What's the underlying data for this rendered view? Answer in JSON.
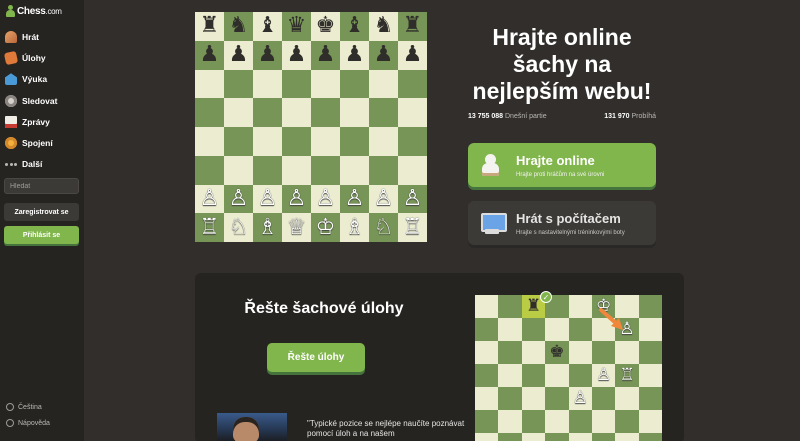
{
  "logo": {
    "name": "Chess",
    "domain": ".com"
  },
  "sidebar": {
    "items": [
      {
        "label": "Hrát",
        "icon": "play-icon"
      },
      {
        "label": "Úlohy",
        "icon": "puzzle-icon"
      },
      {
        "label": "Výuka",
        "icon": "learn-icon"
      },
      {
        "label": "Sledovat",
        "icon": "binoculars-icon"
      },
      {
        "label": "Zprávy",
        "icon": "news-icon"
      },
      {
        "label": "Spojení",
        "icon": "social-icon"
      },
      {
        "label": "Další",
        "icon": "more-icon"
      }
    ],
    "search_placeholder": "Hledat",
    "register_label": "Zaregistrovat se",
    "login_label": "Přihlásit se",
    "language_label": "Čeština",
    "help_label": "Nápověda"
  },
  "hero": {
    "title": "Hrajte online šachy na nejlepším webu!",
    "games_today_count": "13 755 088",
    "games_today_label": "Dnešní partie",
    "playing_count": "131 970",
    "playing_label": "Probíhá",
    "play_online_title": "Hrajte online",
    "play_online_sub": "Hrajte proti hráčům na své úrovni",
    "play_computer_title": "Hrát s počítačem",
    "play_computer_sub": "Hrajte s nastavitelnými tréninkovými boty"
  },
  "board": {
    "rows": [
      [
        "♜",
        "♞",
        "♝",
        "♛",
        "♚",
        "♝",
        "♞",
        "♜"
      ],
      [
        "♟",
        "♟",
        "♟",
        "♟",
        "♟",
        "♟",
        "♟",
        "♟"
      ],
      [
        "",
        "",
        "",
        "",
        "",
        "",
        "",
        ""
      ],
      [
        "",
        "",
        "",
        "",
        "",
        "",
        "",
        ""
      ],
      [
        "",
        "",
        "",
        "",
        "",
        "",
        "",
        ""
      ],
      [
        "",
        "",
        "",
        "",
        "",
        "",
        "",
        ""
      ],
      [
        "♙",
        "♙",
        "♙",
        "♙",
        "♙",
        "♙",
        "♙",
        "♙"
      ],
      [
        "♖",
        "♘",
        "♗",
        "♕",
        "♔",
        "♗",
        "♘",
        "♖"
      ]
    ]
  },
  "puzzles": {
    "title": "Řešte šachové úlohy",
    "button_label": "Řešte úlohy",
    "quote": "\"Typické pozice se nejlépe naučíte poznávat pomocí úloh a na našem",
    "board_rows": [
      [
        "",
        "",
        "♜",
        "",
        "",
        "♔",
        "",
        ""
      ],
      [
        "",
        "",
        "",
        "",
        "",
        "",
        "♙",
        ""
      ],
      [
        "",
        "",
        "",
        "♚",
        "",
        "",
        "",
        ""
      ],
      [
        "",
        "",
        "",
        "",
        "",
        "♙",
        "♖",
        ""
      ],
      [
        "",
        "",
        "",
        "",
        "♙",
        "",
        "",
        ""
      ],
      [
        "",
        "",
        "",
        "",
        "",
        "",
        "",
        ""
      ],
      [
        "",
        "",
        "",
        "",
        "",
        "",
        "",
        ""
      ]
    ],
    "colors": {
      "accent": "#81b64c",
      "move_arrow": "#f0873a"
    }
  }
}
